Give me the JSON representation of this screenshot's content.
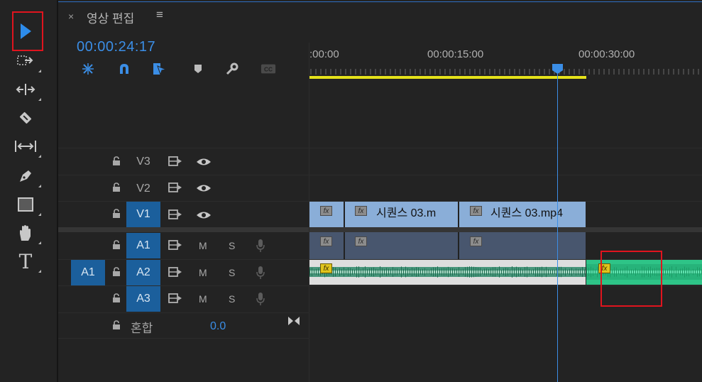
{
  "panel": {
    "close_symbol": "×",
    "title": "영상 편집",
    "menu_symbol": "≡",
    "timecode": "00:00:24:17"
  },
  "header_icons": [
    "nest-snap-icon",
    "magnet-snap-icon",
    "linked-selection-icon",
    "add-marker-icon",
    "settings-wrench-icon",
    "captions-icon"
  ],
  "toolbar": {
    "tools": [
      "selection-tool-icon",
      "track-select-forward-icon",
      "ripple-edit-icon",
      "razor-icon",
      "slip-icon",
      "pen-icon",
      "rectangle-icon",
      "hand-icon",
      "type-icon"
    ],
    "type_glyph": "T"
  },
  "ruler": {
    "labels": [
      ":00:00",
      "00:00:15:00",
      "00:00:30:00"
    ]
  },
  "tracks": {
    "video": [
      {
        "name": "V3",
        "active": false
      },
      {
        "name": "V2",
        "active": false
      },
      {
        "name": "V1",
        "active": true
      }
    ],
    "audio": [
      {
        "name": "A1",
        "active": true,
        "m": "M",
        "s": "S"
      },
      {
        "name": "A2",
        "active": true,
        "m": "M",
        "s": "S"
      },
      {
        "name": "A3",
        "active": true,
        "m": "M",
        "s": "S"
      }
    ],
    "source_patch": "A1",
    "mix_label": "혼합",
    "mix_value": "0.0"
  },
  "clips": {
    "v1": [
      {
        "label": ""
      },
      {
        "label": "시퀀스 03.m"
      },
      {
        "label": "시퀀스 03.mp4"
      }
    ],
    "fx_label": "fx"
  },
  "colors": {
    "accent_blue": "#3b8ee6",
    "track_active": "#1b5f9c",
    "video_clip": "#8aaed8",
    "audio_clip_green": "#2ec487",
    "work_area": "#e5e21a",
    "highlight_red": "#e0141e"
  }
}
